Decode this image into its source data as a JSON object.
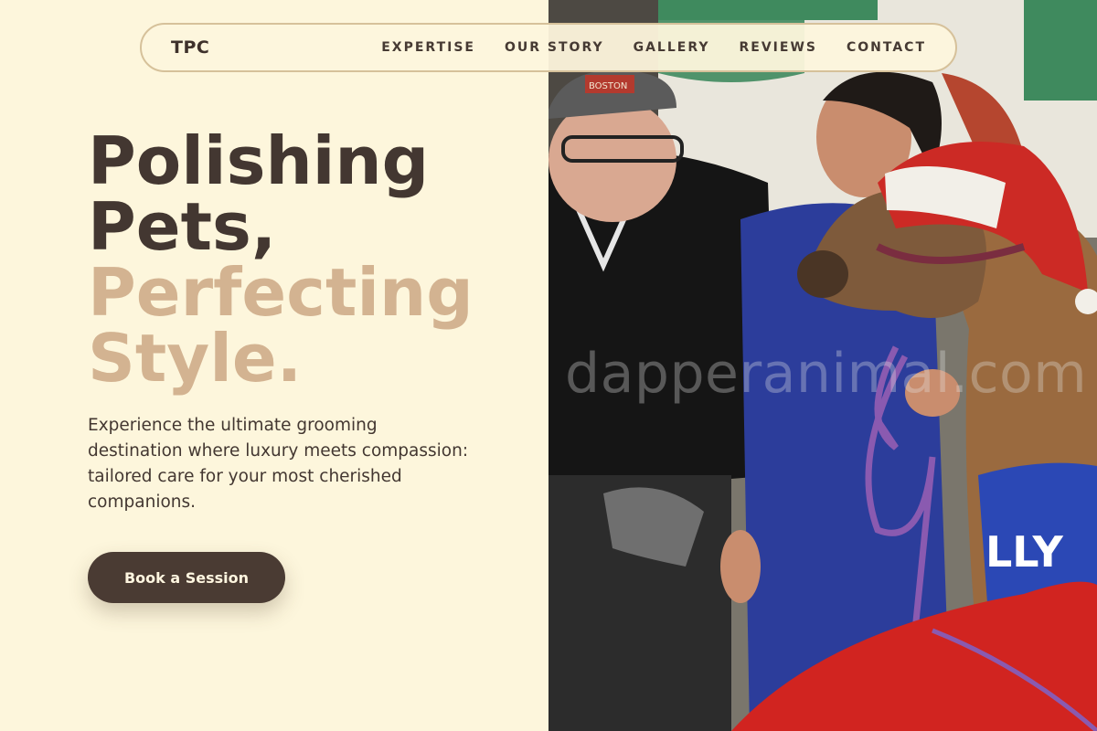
{
  "nav": {
    "logo": "TPC",
    "links": [
      "EXPERTISE",
      "OUR STORY",
      "GALLERY",
      "REVIEWS",
      "CONTACT"
    ]
  },
  "hero": {
    "headline_dark_1": "Polishing",
    "headline_dark_2": "Pets,",
    "headline_tan_1": "Perfecting",
    "headline_tan_2": "Style.",
    "description": "Experience the ultimate grooming destination where luxury meets compassion: tailored care for your most cherished companions.",
    "cta_label": "Book a Session"
  },
  "photo": {
    "watermark": "dapperanimal.com",
    "blanket_text": "LLY",
    "cap_text": "BOSTON"
  },
  "colors": {
    "background": "#fdf6dc",
    "text_dark": "#433731",
    "accent_tan": "#d3b391",
    "button": "#4a3b33",
    "nav_border": "#d6c19a"
  }
}
